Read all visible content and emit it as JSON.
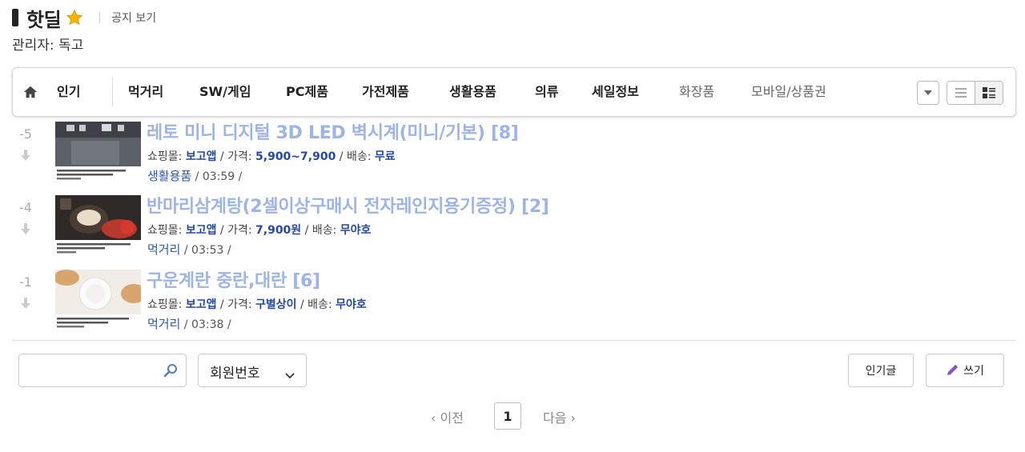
{
  "header": {
    "title": "핫딜",
    "notice": "공지 보기",
    "admin": "관리자: 독고"
  },
  "categories": [
    {
      "label": "인기",
      "state": "active"
    },
    {
      "label": "먹거리",
      "state": "normal"
    },
    {
      "label": "SW/게임",
      "state": "normal"
    },
    {
      "label": "PC제품",
      "state": "normal"
    },
    {
      "label": "가전제품",
      "state": "normal"
    },
    {
      "label": "생활용품",
      "state": "normal"
    },
    {
      "label": "의류",
      "state": "normal"
    },
    {
      "label": "세일정보",
      "state": "normal"
    },
    {
      "label": "화장품",
      "state": "muted"
    },
    {
      "label": "모바일/상품권",
      "state": "muted"
    }
  ],
  "posts": [
    {
      "rank": "-5",
      "title": "레토 미니 디지털 3D LED 벽시계(미니/기본) [8]",
      "shop_label": "쇼핑몰:",
      "shop": "보고앱",
      "price_label": "가격:",
      "price": "5,900~7,900",
      "ship_label": "배송:",
      "ship": "무료",
      "category": "생활용품",
      "time": "03:59"
    },
    {
      "rank": "-4",
      "title": "반마리삼계탕(2셀이상구매시 전자레인지용기증정) [2]",
      "shop_label": "쇼핑몰:",
      "shop": "보고앱",
      "price_label": "가격:",
      "price": "7,900원",
      "ship_label": "배송:",
      "ship": "무야호",
      "category": "먹거리",
      "time": "03:53"
    },
    {
      "rank": "-1",
      "title": "구운계란 중란,대란 [6]",
      "shop_label": "쇼핑몰:",
      "shop": "보고앱",
      "price_label": "가격:",
      "price": "구별상이",
      "ship_label": "배송:",
      "ship": "무야호",
      "category": "먹거리",
      "time": "03:38"
    }
  ],
  "search": {
    "value": "",
    "select_value": "회원번호"
  },
  "buttons": {
    "popular": "인기글",
    "write": "쓰기"
  },
  "pager": {
    "prev": "‹ 이전",
    "current": "1",
    "next": "다음 ›"
  },
  "colors": {
    "accent": "#2b58b5",
    "title_visited": "#9db4e8"
  }
}
